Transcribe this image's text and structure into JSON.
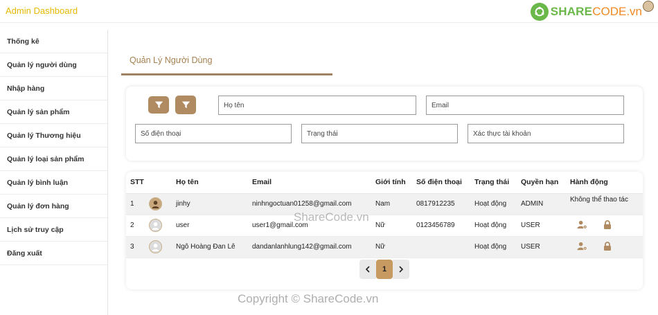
{
  "app": {
    "title": "Admin Dashboard"
  },
  "logo": {
    "part1": "SHARE",
    "part2": "CODE.vn"
  },
  "sidebar": {
    "items": [
      {
        "label": "Thống kê"
      },
      {
        "label": "Quản lý người dùng"
      },
      {
        "label": "Nhập hàng"
      },
      {
        "label": "Quản lý sản phẩm"
      },
      {
        "label": "Quản lý Thương hiệu"
      },
      {
        "label": "Quản lý loại sản phẩm"
      },
      {
        "label": "Quản lý bình luận"
      },
      {
        "label": "Quản lý đơn hàng"
      },
      {
        "label": "Lịch sử truy cập"
      },
      {
        "label": "Đăng xuất"
      }
    ]
  },
  "page": {
    "title": "Quản Lý Người Dùng"
  },
  "filters": {
    "name": "Họ tên",
    "email": "Email",
    "phone": "Số điện thoại",
    "status": "Trạng thái",
    "verify": "Xác thực tài khoản"
  },
  "table": {
    "headers": [
      "STT",
      "",
      "Họ tên",
      "Email",
      "Giới tính",
      "Số điện thoại",
      "Trạng thái",
      "Quyền hạn",
      "Hành động"
    ],
    "rows": [
      {
        "stt": "1",
        "name": "jinhy",
        "email": "ninhngoctuan01258@gmail.com",
        "gender": "Nam",
        "phone": "0817912235",
        "status": "Hoạt động",
        "role": "ADMIN",
        "action": "Không thể thao tác"
      },
      {
        "stt": "2",
        "name": "user",
        "email": "user1@gmail.com",
        "gender": "Nữ",
        "phone": "0123456789",
        "status": "Hoạt động",
        "role": "USER",
        "action": ""
      },
      {
        "stt": "3",
        "name": "Ngô Hoàng Đan Lê",
        "email": "dandanlanhlung142@gmail.com",
        "gender": "Nữ",
        "phone": "",
        "status": "Hoạt động",
        "role": "USER",
        "action": ""
      }
    ]
  },
  "pagination": {
    "current": "1"
  },
  "watermark": {
    "center": "ShareCode.vn",
    "footer": "Copyright © ShareCode.vn"
  },
  "colors": {
    "accent": "#b08a60",
    "brand": "#e6b800"
  }
}
